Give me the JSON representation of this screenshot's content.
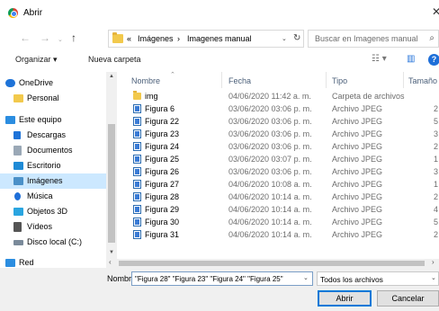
{
  "window": {
    "title": "Abrir",
    "close_glyph": "✕"
  },
  "navigation": {
    "back_glyph": "←",
    "forward_glyph": "→",
    "dropdown_glyph": "⌄",
    "up_glyph": "↑",
    "breadcrumb": [
      "«",
      "Imágenes",
      "›",
      "Imagenes manual"
    ],
    "address_dropdown_glyph": "⌄",
    "refresh_glyph": "↻",
    "search_placeholder": "Buscar en Imagenes manual",
    "search_glyph": "⌕"
  },
  "toolbar": {
    "organize_label": "Organizar ▾",
    "new_folder_label": "Nueva carpeta",
    "view_glyph": "☷ ▾",
    "pane_glyph": "▥",
    "help_glyph": "?"
  },
  "sidebar": {
    "items": [
      {
        "label": "OneDrive",
        "icon": "cloud-icon",
        "color": "#1e73d8"
      },
      {
        "label": "Personal",
        "icon": "folder-icon",
        "color": "#f2c94c"
      },
      {
        "label": "Este equipo",
        "icon": "computer-icon",
        "color": "#2b8de0"
      },
      {
        "label": "Descargas",
        "icon": "download-icon",
        "color": "#1e73d8"
      },
      {
        "label": "Documentos",
        "icon": "documents-icon",
        "color": "#9aa8b6"
      },
      {
        "label": "Escritorio",
        "icon": "desktop-icon",
        "color": "#1e8ad6"
      },
      {
        "label": "Imágenes",
        "icon": "pictures-icon",
        "color": "#4a90c8",
        "selected": true
      },
      {
        "label": "Música",
        "icon": "music-icon",
        "color": "#1e6fd9"
      },
      {
        "label": "Objetos 3D",
        "icon": "objects3d-icon",
        "color": "#2aa5e0"
      },
      {
        "label": "Vídeos",
        "icon": "videos-icon",
        "color": "#555555"
      },
      {
        "label": "Disco local (C:)",
        "icon": "disk-icon",
        "color": "#7a8a9a"
      },
      {
        "label": "Red",
        "icon": "network-icon",
        "color": "#2b8de0"
      }
    ],
    "scroll_up_glyph": "▲",
    "scroll_down_glyph": "▼"
  },
  "file_list": {
    "columns": [
      "Nombre",
      "Fecha",
      "Tipo",
      "Tamaño"
    ],
    "sort_glyph": "⌃",
    "rows": [
      {
        "name": "img",
        "date": "04/06/2020 11:42 a. m.",
        "type": "Carpeta de archivos",
        "size": "",
        "kind": "folder"
      },
      {
        "name": "Figura 6",
        "date": "03/06/2020 03:06 p. m.",
        "type": "Archivo JPEG",
        "size": "2",
        "kind": "jpeg"
      },
      {
        "name": "Figura 22",
        "date": "03/06/2020 03:06 p. m.",
        "type": "Archivo JPEG",
        "size": "5",
        "kind": "jpeg"
      },
      {
        "name": "Figura 23",
        "date": "03/06/2020 03:06 p. m.",
        "type": "Archivo JPEG",
        "size": "3",
        "kind": "jpeg"
      },
      {
        "name": "Figura 24",
        "date": "03/06/2020 03:06 p. m.",
        "type": "Archivo JPEG",
        "size": "2",
        "kind": "jpeg"
      },
      {
        "name": "Figura 25",
        "date": "03/06/2020 03:07 p. m.",
        "type": "Archivo JPEG",
        "size": "1",
        "kind": "jpeg"
      },
      {
        "name": "Figura 26",
        "date": "03/06/2020 03:06 p. m.",
        "type": "Archivo JPEG",
        "size": "3",
        "kind": "jpeg"
      },
      {
        "name": "Figura 27",
        "date": "04/06/2020 10:08 a. m.",
        "type": "Archivo JPEG",
        "size": "1",
        "kind": "jpeg"
      },
      {
        "name": "Figura 28",
        "date": "04/06/2020 10:14 a. m.",
        "type": "Archivo JPEG",
        "size": "2",
        "kind": "jpeg"
      },
      {
        "name": "Figura 29",
        "date": "04/06/2020 10:14 a. m.",
        "type": "Archivo JPEG",
        "size": "4",
        "kind": "jpeg"
      },
      {
        "name": "Figura 30",
        "date": "04/06/2020 10:14 a. m.",
        "type": "Archivo JPEG",
        "size": "5",
        "kind": "jpeg"
      },
      {
        "name": "Figura 31",
        "date": "04/06/2020 10:14 a. m.",
        "type": "Archivo JPEG",
        "size": "2",
        "kind": "jpeg"
      }
    ],
    "scroll_left_glyph": "‹",
    "scroll_right_glyph": "›"
  },
  "footer": {
    "filename_label": "Nombre:",
    "filename_value": "\"Figura 28\" \"Figura 23\" \"Figura 24\" \"Figura 25\"",
    "filename_dropdown_glyph": "⌄",
    "filetype_value": "Todos los archivos",
    "filetype_dropdown_glyph": "⌄",
    "open_label": "Abrir",
    "cancel_label": "Cancelar"
  },
  "colors": {
    "selection": "#cce8ff",
    "accent": "#0078d7",
    "header_text": "#4c607a"
  }
}
